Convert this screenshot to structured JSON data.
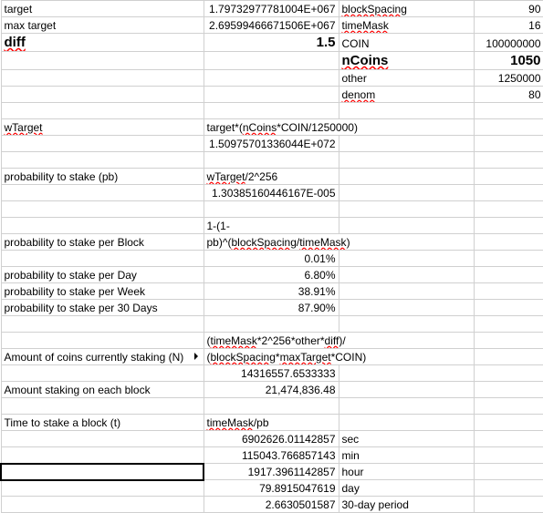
{
  "row1": {
    "a": "target",
    "c": "1.79732977781004E+067",
    "d": "blockSpacing",
    "e": "90"
  },
  "row2": {
    "a": "max target",
    "c": "2.69599466671506E+067",
    "d": "timeMask",
    "e": "16"
  },
  "row3": {
    "a": "diff",
    "c": "1.5",
    "d": "COIN",
    "e": "100000000"
  },
  "row4": {
    "d": "nCoins",
    "e": "1050"
  },
  "row5": {
    "d": "other",
    "e": "1250000"
  },
  "row6": {
    "d": "denom",
    "e": "80"
  },
  "row8": {
    "a": "wTarget",
    "c_pre": "target*(",
    "c_mid": "nCoins",
    "c_post": "*COIN/1250000)"
  },
  "row9": {
    "c": "1.50975701336044E+072"
  },
  "row11": {
    "a": "probability to stake (pb)",
    "c_pre": "wTarget",
    "c_post": "/2^256"
  },
  "row12": {
    "c": "1.30385160446167E-005"
  },
  "row14": {
    "c": "1-(1-"
  },
  "row15": {
    "a": "probability to stake per Block",
    "c_pre": "pb)^(",
    "c_mid1": "blockSpacing",
    "c_slash": "/",
    "c_mid2": "timeMask",
    "c_post": ")"
  },
  "row16": {
    "c": "0.01%"
  },
  "row17": {
    "a": "probability to stake per Day",
    "c": "6.80%"
  },
  "row18": {
    "a": "probability to stake per Week",
    "c": "38.91%"
  },
  "row19": {
    "a": "probability to stake per 30 Days",
    "c": "87.90%"
  },
  "row21": {
    "c_open": "(",
    "c_p1": "timeMask",
    "c_m1": "*2^256*other*",
    "c_p2": "diff",
    "c_close": ")/"
  },
  "row22": {
    "a": "Amount of coins currently staking (N)",
    "c_open": "(",
    "c_p1": "blockSpacing",
    "c_m1": "*",
    "c_p2": "maxTarget",
    "c_m2": "*COIN)"
  },
  "row23": {
    "c": "14316557.6533333"
  },
  "row24": {
    "a": "Amount staking on each block",
    "c": "21,474,836.48"
  },
  "row26": {
    "a": "Time to stake a block (t)",
    "c_p1": "timeMask",
    "c_post": "/pb"
  },
  "row27": {
    "c": "6902626.01142857",
    "d": "sec"
  },
  "row28": {
    "c": "115043.766857143",
    "d": "min"
  },
  "row29": {
    "c": "1917.3961142857",
    "d": "hour"
  },
  "row30": {
    "c": "79.8915047619",
    "d": "day"
  },
  "row31": {
    "c": "2.6630501587",
    "d": "30-day period"
  }
}
